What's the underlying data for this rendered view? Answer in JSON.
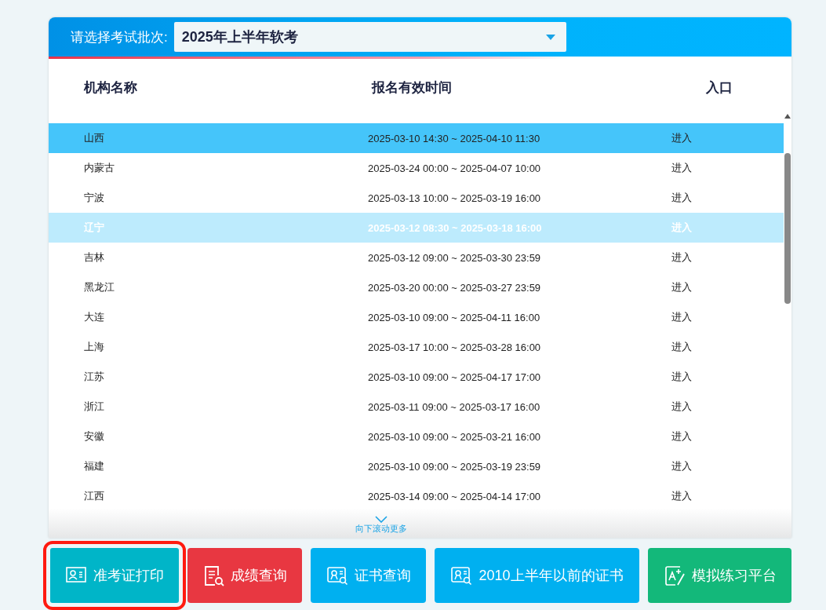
{
  "batch_selector": {
    "label": "请选择考试批次:",
    "value": "2025年上半年软考"
  },
  "table": {
    "columns": [
      "机构名称",
      "报名有效时间",
      "入口"
    ],
    "rows": [
      {
        "name": "山西",
        "time": "2025-03-10 14:30 ~ 2025-04-10 11:30",
        "entry": "进入",
        "selected": true,
        "hovered": false
      },
      {
        "name": "内蒙古",
        "time": "2025-03-24 00:00 ~ 2025-04-07 10:00",
        "entry": "进入",
        "selected": false,
        "hovered": false
      },
      {
        "name": "宁波",
        "time": "2025-03-13 10:00 ~ 2025-03-19 16:00",
        "entry": "进入",
        "selected": false,
        "hovered": false
      },
      {
        "name": "辽宁",
        "time": "2025-03-12 08:30 ~ 2025-03-18 16:00",
        "entry": "进入",
        "selected": false,
        "hovered": true
      },
      {
        "name": "吉林",
        "time": "2025-03-12 09:00 ~ 2025-03-30 23:59",
        "entry": "进入",
        "selected": false,
        "hovered": false
      },
      {
        "name": "黑龙江",
        "time": "2025-03-20 00:00 ~ 2025-03-27 23:59",
        "entry": "进入",
        "selected": false,
        "hovered": false
      },
      {
        "name": "大连",
        "time": "2025-03-10 09:00 ~ 2025-04-11 16:00",
        "entry": "进入",
        "selected": false,
        "hovered": false
      },
      {
        "name": "上海",
        "time": "2025-03-17 10:00 ~ 2025-03-28 16:00",
        "entry": "进入",
        "selected": false,
        "hovered": false
      },
      {
        "name": "江苏",
        "time": "2025-03-10 09:00 ~ 2025-04-17 17:00",
        "entry": "进入",
        "selected": false,
        "hovered": false
      },
      {
        "name": "浙江",
        "time": "2025-03-11 09:00 ~ 2025-03-17 16:00",
        "entry": "进入",
        "selected": false,
        "hovered": false
      },
      {
        "name": "安徽",
        "time": "2025-03-10 09:00 ~ 2025-03-21 16:00",
        "entry": "进入",
        "selected": false,
        "hovered": false
      },
      {
        "name": "福建",
        "time": "2025-03-10 09:00 ~ 2025-03-19 23:59",
        "entry": "进入",
        "selected": false,
        "hovered": false
      },
      {
        "name": "江西",
        "time": "2025-03-14 09:00 ~ 2025-04-14 17:00",
        "entry": "进入",
        "selected": false,
        "hovered": false
      }
    ],
    "scroll_hint": "向下滚动更多"
  },
  "actions": [
    {
      "label": "准考证打印",
      "kind": "admission",
      "color": "#00b5c8",
      "highlighted": true
    },
    {
      "label": "成绩查询",
      "kind": "score",
      "color": "#e83741",
      "highlighted": false
    },
    {
      "label": "证书查询",
      "kind": "certificate",
      "color": "#00b0f0",
      "highlighted": false
    },
    {
      "label": "2010上半年以前的证书",
      "kind": "certificate",
      "color": "#00b0f0",
      "highlighted": false
    },
    {
      "label": "模拟练习平台",
      "kind": "practice",
      "color": "#13b87a",
      "highlighted": false
    }
  ]
}
